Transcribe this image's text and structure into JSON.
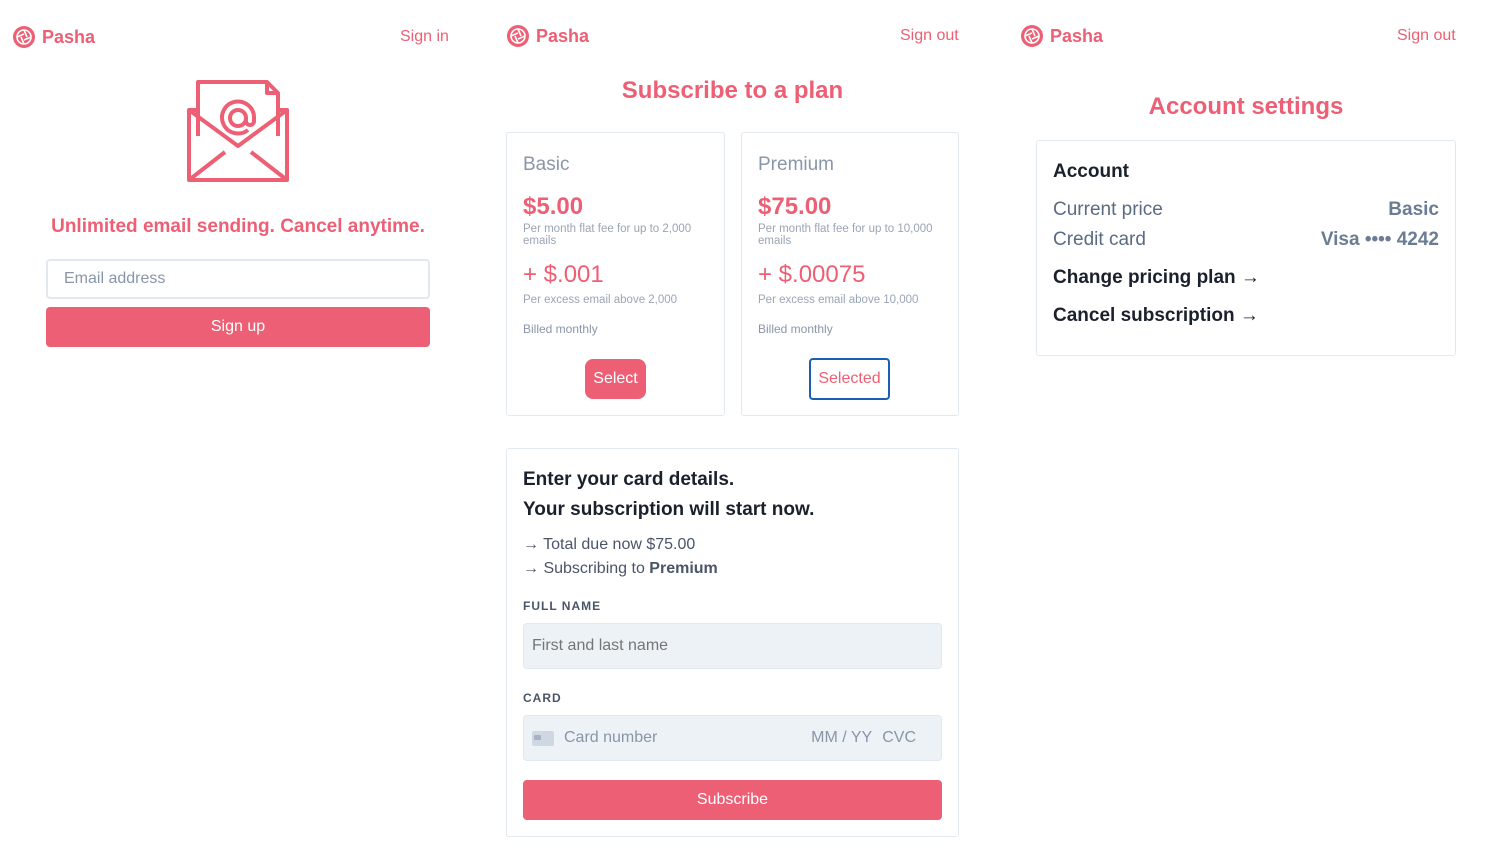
{
  "brand": {
    "name": "Pasha",
    "color": "#ed5f74",
    "icon": "aperture-icon"
  },
  "panel1": {
    "nav_link": "Sign in",
    "illustration": "envelope-at-icon",
    "tagline": "Unlimited email sending. Cancel anytime.",
    "email_placeholder": "Email address",
    "signup_label": "Sign up"
  },
  "panel2": {
    "nav_link": "Sign out",
    "title": "Subscribe to a plan",
    "plans": [
      {
        "name": "Basic",
        "price": "$5.00",
        "price_note": "Per month flat fee for up to 2,000 emails",
        "excess": "+ $.001",
        "excess_note": "Per excess email above 2,000",
        "billing": "Billed monthly",
        "button": "Select"
      },
      {
        "name": "Premium",
        "price": "$75.00",
        "price_note": "Per month flat fee for up to 10,000 emails",
        "excess": "+ $.00075",
        "excess_note": "Per excess email above 10,000",
        "billing": "Billed monthly",
        "button": "Selected"
      }
    ],
    "checkout": {
      "heading_line1": "Enter your card details.",
      "heading_line2": "Your subscription will start now.",
      "total_prefix": "→ Total due now",
      "total_value": "$75.00",
      "subscribing_prefix": "→ Subscribing to",
      "subscribing_plan": "Premium",
      "full_name_label": "FULL NAME",
      "full_name_placeholder": "First and last name",
      "card_label": "CARD",
      "card_number_placeholder": "Card number",
      "card_expiry_placeholder": "MM / YY",
      "card_cvc_placeholder": "CVC",
      "subscribe_label": "Subscribe"
    }
  },
  "panel3": {
    "nav_link": "Sign out",
    "title": "Account settings",
    "section_heading": "Account",
    "rows": [
      {
        "label": "Current price",
        "value": "Basic"
      },
      {
        "label": "Credit card",
        "value": "Visa •••• 4242"
      }
    ],
    "links": [
      "Change pricing plan →",
      "Cancel subscription →"
    ]
  }
}
